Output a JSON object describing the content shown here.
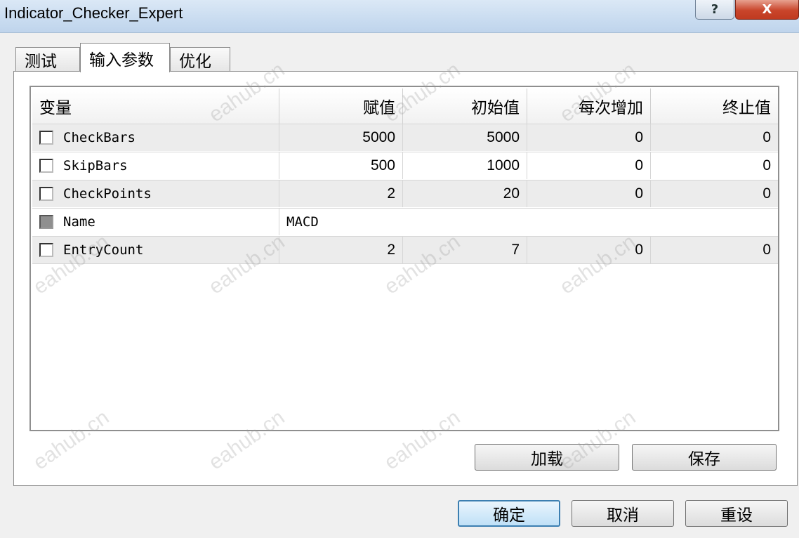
{
  "window": {
    "title": "Indicator_Checker_Expert",
    "help_label": "?",
    "close_label": "X"
  },
  "tabs": [
    {
      "label": "测试"
    },
    {
      "label": "输入参数"
    },
    {
      "label": "优化"
    }
  ],
  "table": {
    "headers": [
      "变量",
      "赋值",
      "初始值",
      "每次增加",
      "终止值"
    ],
    "rows": [
      {
        "name": "CheckBars",
        "value": "5000",
        "start": "5000",
        "step": "0",
        "stop": "0"
      },
      {
        "name": "SkipBars",
        "value": "500",
        "start": "1000",
        "step": "0",
        "stop": "0"
      },
      {
        "name": "CheckPoints",
        "value": "2",
        "start": "20",
        "step": "0",
        "stop": "0"
      },
      {
        "name": "Name",
        "value": "MACD"
      },
      {
        "name": "EntryCount",
        "value": "2",
        "start": "7",
        "step": "0",
        "stop": "0"
      }
    ]
  },
  "buttons": {
    "load": "加载",
    "save": "保存",
    "ok": "确定",
    "cancel": "取消",
    "reset": "重设"
  },
  "watermark": "eahub.cn",
  "colors": {
    "titlebar": "#c9dcf0",
    "close_button": "#c9452b",
    "ok_button_border": "#3c7fb1",
    "alt_row": "#ececec"
  }
}
